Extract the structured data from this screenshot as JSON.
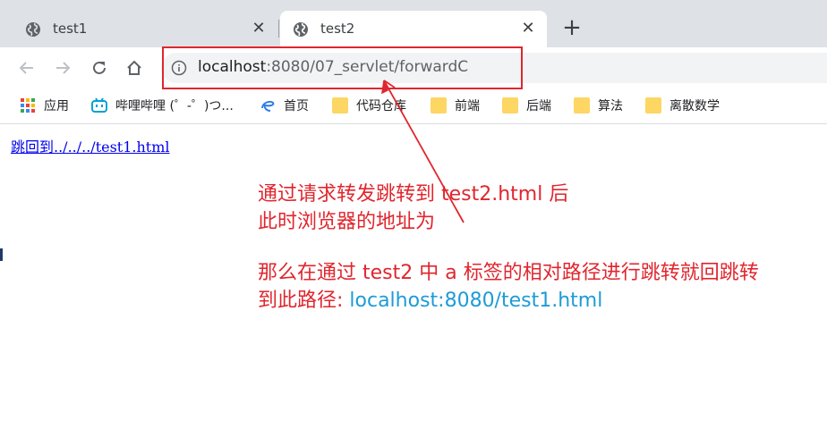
{
  "tabs": [
    {
      "title": "test1",
      "active": false
    },
    {
      "title": "test2",
      "active": true
    }
  ],
  "toolbar": {
    "url_host": "localhost",
    "url_rest": ":8080/07_servlet/forwardC"
  },
  "bookmarks": [
    {
      "label": "应用",
      "icon": "apps-grid-icon"
    },
    {
      "label": "哔哩哔哩 (゜-゜)つ...",
      "icon": "bilibili-icon"
    },
    {
      "label": "首页",
      "icon": "homepage-swirl-icon"
    },
    {
      "label": "代码仓库",
      "icon": "folder-icon"
    },
    {
      "label": "前端",
      "icon": "folder-icon"
    },
    {
      "label": "后端",
      "icon": "folder-icon"
    },
    {
      "label": "算法",
      "icon": "folder-icon"
    },
    {
      "label": "离散数学",
      "icon": "folder-icon"
    }
  ],
  "content": {
    "link_text": "跳回到../../../test1.html"
  },
  "annotations": {
    "line1": "通过请求转发跳转到 test2.html 后",
    "line2": "此时浏览器的地址为",
    "line3": "那么在通过 test2 中 a 标签的相对路径进行跳转就回跳转",
    "line4_prefix": "到此路径: ",
    "line4_url": "localhost:8080/test1.html"
  },
  "colors": {
    "annotation_red": "#e0262e",
    "annotation_blue": "#1e9bd7",
    "link_blue": "#0000ee",
    "tabstrip_bg": "#dee1e6"
  }
}
